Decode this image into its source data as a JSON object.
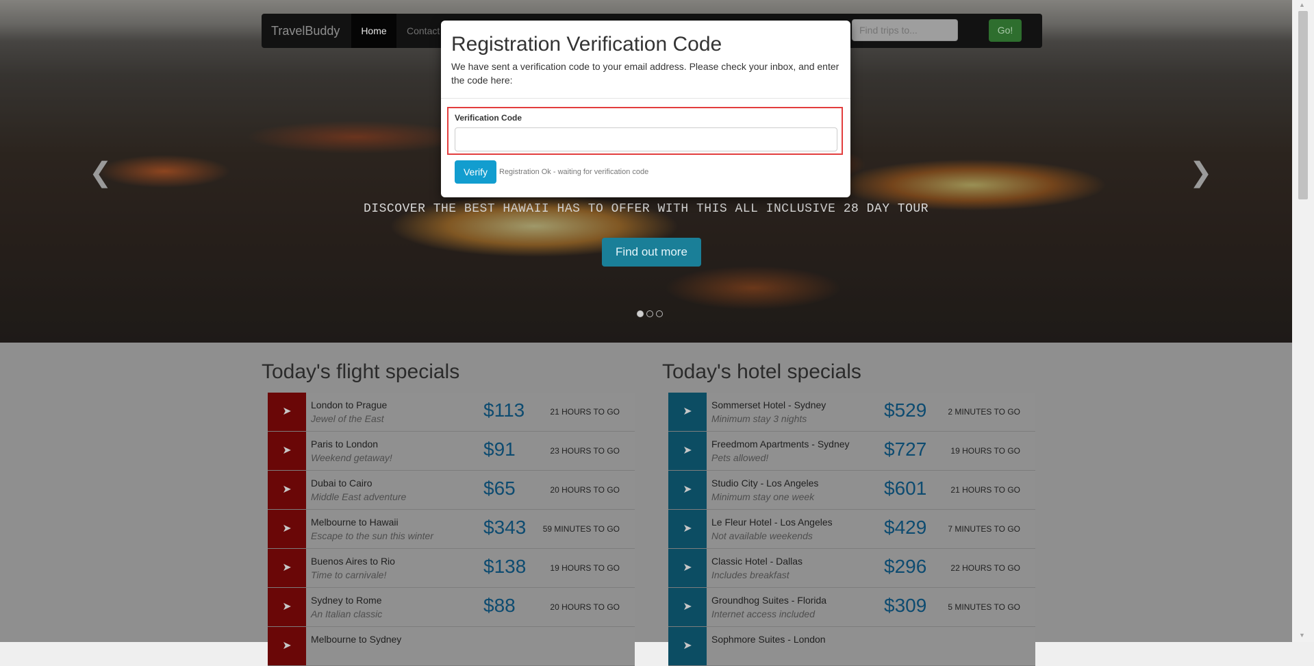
{
  "navbar": {
    "brand": "TravelBuddy",
    "home_label": "Home",
    "contact_label": "Contact",
    "search_placeholder": "Find trips to...",
    "go_label": "Go!"
  },
  "hero": {
    "caption": "DISCOVER THE BEST HAWAII HAS TO OFFER WITH THIS ALL INCLUSIVE 28 DAY TOUR",
    "cta_label": "Find out more",
    "prev_icon": "chevron-left-icon",
    "next_icon": "chevron-right-icon",
    "slides": 3,
    "active_slide": 1
  },
  "flights": {
    "heading": "Today's flight specials",
    "icon": "plane-icon",
    "accent_color": "#c40a0a",
    "items": [
      {
        "title": "London to Prague",
        "subtitle": "Jewel of the East",
        "price": "$113",
        "time": "21 HOURS TO GO"
      },
      {
        "title": "Paris to London",
        "subtitle": "Weekend getaway!",
        "price": "$91",
        "time": "23 HOURS TO GO"
      },
      {
        "title": "Dubai to Cairo",
        "subtitle": "Middle East adventure",
        "price": "$65",
        "time": "20 HOURS TO GO"
      },
      {
        "title": "Melbourne to Hawaii",
        "subtitle": "Escape to the sun this winter",
        "price": "$343",
        "time": "59 MINUTES TO GO"
      },
      {
        "title": "Buenos Aires to Rio",
        "subtitle": "Time to carnivale!",
        "price": "$138",
        "time": "19 HOURS TO GO"
      },
      {
        "title": "Sydney to Rome",
        "subtitle": "An Italian classic",
        "price": "$88",
        "time": "20 HOURS TO GO"
      },
      {
        "title": "Melbourne to Sydney",
        "subtitle": "",
        "price": "",
        "time": ""
      }
    ]
  },
  "hotels": {
    "heading": "Today's hotel specials",
    "icon": "plane-icon",
    "accent_color": "#168fbf",
    "items": [
      {
        "title": "Sommerset Hotel - Sydney",
        "subtitle": "Minimum stay 3 nights",
        "price": "$529",
        "time": "2 MINUTES TO GO"
      },
      {
        "title": "Freedmom Apartments - Sydney",
        "subtitle": "Pets allowed!",
        "price": "$727",
        "time": "19 HOURS TO GO"
      },
      {
        "title": "Studio City - Los Angeles",
        "subtitle": "Minimum stay one week",
        "price": "$601",
        "time": "21 HOURS TO GO"
      },
      {
        "title": "Le Fleur Hotel - Los Angeles",
        "subtitle": "Not available weekends",
        "price": "$429",
        "time": "7 MINUTES TO GO"
      },
      {
        "title": "Classic Hotel - Dallas",
        "subtitle": "Includes breakfast",
        "price": "$296",
        "time": "22 HOURS TO GO"
      },
      {
        "title": "Groundhog Suites - Florida",
        "subtitle": "Internet access included",
        "price": "$309",
        "time": "5 MINUTES TO GO"
      },
      {
        "title": "Sophmore Suites - London",
        "subtitle": "",
        "price": "",
        "time": ""
      }
    ]
  },
  "modal": {
    "title": "Registration Verification Code",
    "description": "We have sent a verification code to your email address. Please check your inbox, and enter the code here:",
    "field_label": "Verification Code",
    "field_value": "",
    "verify_label": "Verify",
    "status": "Registration Ok - waiting for verification code",
    "highlight_color": "#e23d3d"
  }
}
